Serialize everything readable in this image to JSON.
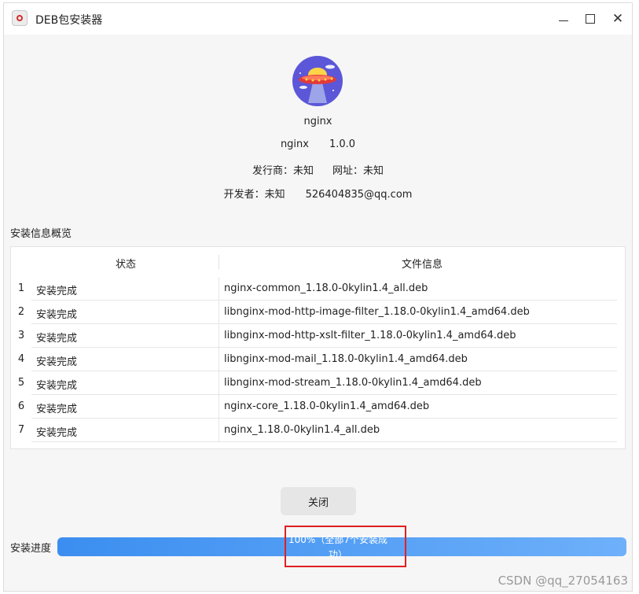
{
  "window": {
    "title": "DEB包安装器"
  },
  "package": {
    "name": "nginx",
    "name_short": "nginx",
    "version": "1.0.0",
    "publisher_label": "发行商：",
    "publisher": "未知",
    "website_label": "网址：",
    "website": "未知",
    "developer_label": "开发者：",
    "developer": "未知",
    "email": "526404835@qq.com"
  },
  "overview": {
    "title": "安装信息概览",
    "columns": [
      "状态",
      "文件信息"
    ],
    "rows": [
      {
        "index": "1",
        "status": "安装完成",
        "file": "nginx-common_1.18.0-0kylin1.4_all.deb"
      },
      {
        "index": "2",
        "status": "安装完成",
        "file": "libnginx-mod-http-image-filter_1.18.0-0kylin1.4_amd64.deb"
      },
      {
        "index": "3",
        "status": "安装完成",
        "file": "libnginx-mod-http-xslt-filter_1.18.0-0kylin1.4_amd64.deb"
      },
      {
        "index": "4",
        "status": "安装完成",
        "file": "libnginx-mod-mail_1.18.0-0kylin1.4_amd64.deb"
      },
      {
        "index": "5",
        "status": "安装完成",
        "file": "libnginx-mod-stream_1.18.0-0kylin1.4_amd64.deb"
      },
      {
        "index": "6",
        "status": "安装完成",
        "file": "nginx-core_1.18.0-0kylin1.4_amd64.deb"
      },
      {
        "index": "7",
        "status": "安装完成",
        "file": "nginx_1.18.0-0kylin1.4_all.deb"
      }
    ]
  },
  "actions": {
    "close_label": "关闭"
  },
  "progress": {
    "label": "安装进度",
    "percent": 100,
    "text": "100%（全部7个安装成功）"
  },
  "watermark": "CSDN @qq_27054163",
  "colors": {
    "accent": "#3b8ef0",
    "highlight": "#e02020"
  }
}
